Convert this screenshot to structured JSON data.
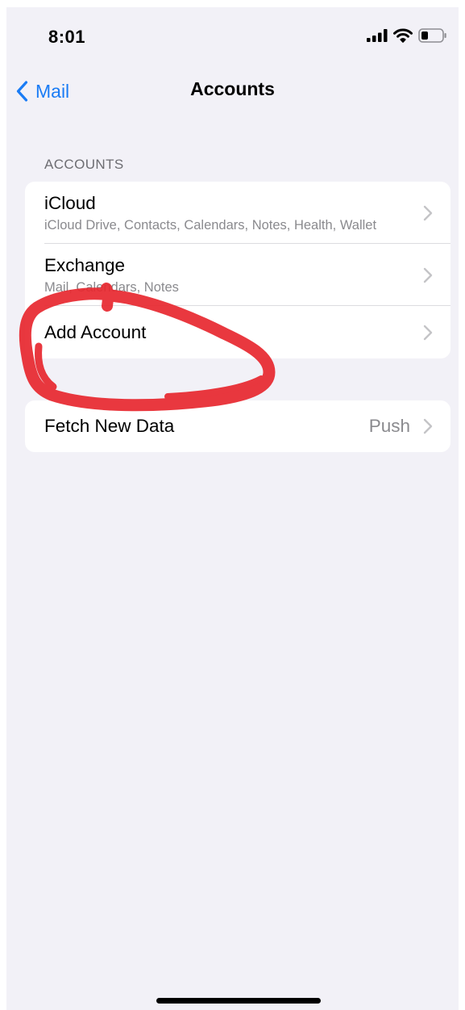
{
  "status_bar": {
    "time": "8:01",
    "icons": [
      "cellular-signal-icon",
      "wifi-icon",
      "battery-icon"
    ]
  },
  "nav": {
    "back_label": "Mail",
    "title": "Accounts"
  },
  "accounts_section": {
    "header": "ACCOUNTS",
    "items": [
      {
        "title": "iCloud",
        "subtitle": "iCloud Drive, Contacts, Calendars, Notes, Health, Wallet"
      },
      {
        "title": "Exchange",
        "subtitle": "Mail, Calendars, Notes"
      },
      {
        "title": "Add Account"
      }
    ]
  },
  "fetch_section": {
    "title": "Fetch New Data",
    "value": "Push"
  },
  "annotation": {
    "description_color": "#e8282f"
  },
  "colors": {
    "accent": "#1a7cf5",
    "background": "#f2f1f7",
    "secondary_text": "#8a8a8e",
    "annotation": "#e8282f"
  }
}
